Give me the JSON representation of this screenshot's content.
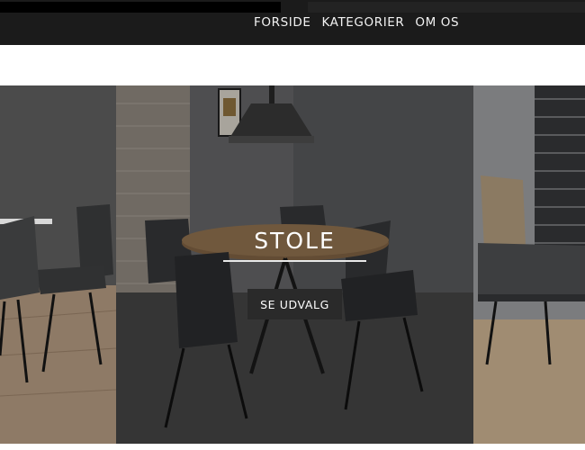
{
  "nav": {
    "items": [
      "FORSIDE",
      "KATEGORIER",
      "OM OS"
    ]
  },
  "slider": {
    "active_slide": {
      "title": "STOLE",
      "button_label": "SE UDVALG"
    }
  },
  "colors": {
    "header_bg": "#1b1b1b",
    "button_bg": "#2a2a2a"
  }
}
